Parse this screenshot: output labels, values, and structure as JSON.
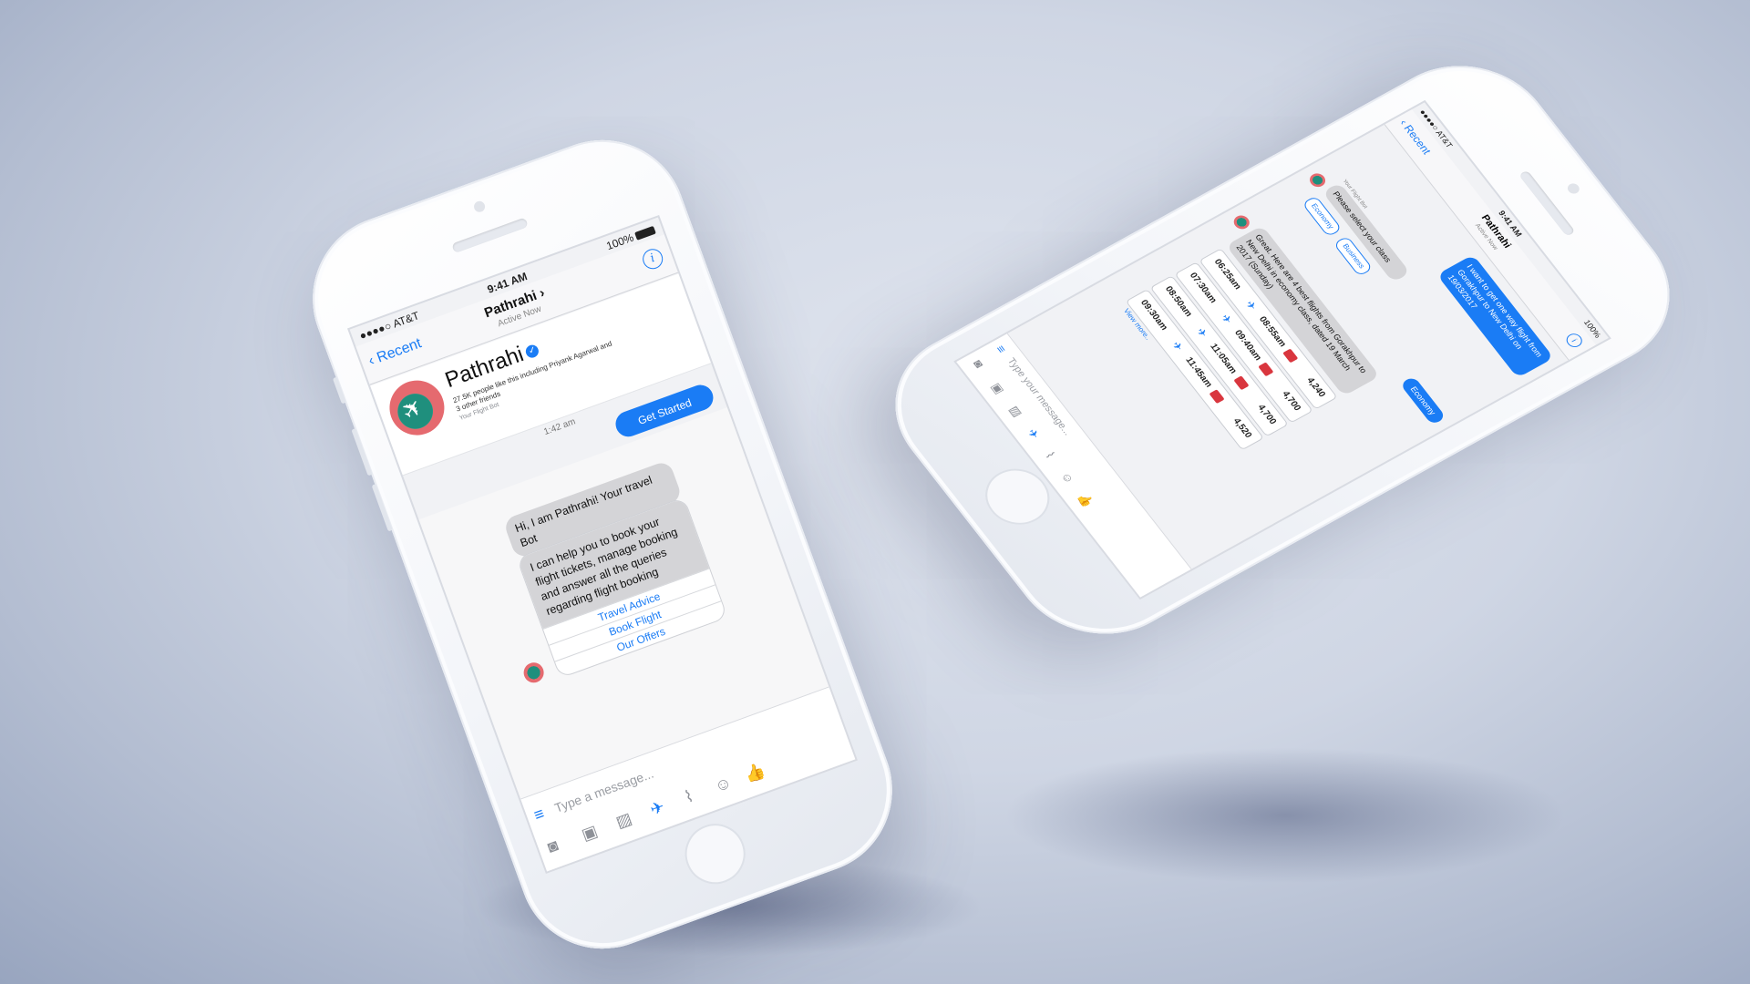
{
  "phone1": {
    "status": {
      "carrier": "●●●●○ AT&T",
      "time": "9:41 AM",
      "battery": "100%"
    },
    "nav": {
      "back": "Recent",
      "title": "Pathrahi",
      "subtitle": "Active Now"
    },
    "profile": {
      "name": "Pathrahi",
      "likes": "27.5K people like this including Priyank Agarwal and 3 other friends",
      "tagline": "Your Flight Bot"
    },
    "time": "1:42 am",
    "get_started": "Get Started",
    "bot_greeting": "Hi, I am Pathrahi! Your travel Bot",
    "bot_intro": "I can help you to book your flight tickets, manage booking and answer all the queries regarding flight booking",
    "quick_replies": [
      "Travel Advice",
      "Book Flight",
      "Our Offers"
    ],
    "composer": {
      "placeholder": "Type a message..."
    }
  },
  "phone2": {
    "status": {
      "carrier": "●●●●○ AT&T",
      "time": "9:41 AM",
      "battery": "100%"
    },
    "nav": {
      "back": "Recent",
      "title": "Pathrahi",
      "subtitle": "Active Now"
    },
    "user_msg": "I want to get one way flight from Gorakhpur to New Delhi on 19/03/2017",
    "bot_label": "Your Flight Bot",
    "class_prompt": "Please select your class",
    "chips": [
      "Economy",
      "Business"
    ],
    "economy_reply": "Economy",
    "results_msg": "Great. Here are 4 best flights from Gorakhpur to New Delhi in economy class, dated 19 March 2017 (Sunday)",
    "flights": [
      {
        "dep": "06:25am",
        "arr": "08:55am",
        "price": "4,240"
      },
      {
        "dep": "07:30am",
        "arr": "09:40am",
        "price": "4,700"
      },
      {
        "dep": "08:50am",
        "arr": "11:05am",
        "price": "4,700"
      },
      {
        "dep": "09:30am",
        "arr": "11:45am",
        "price": "4,520"
      }
    ],
    "view_more": "View more..",
    "composer": {
      "placeholder": "Type your message..."
    }
  }
}
